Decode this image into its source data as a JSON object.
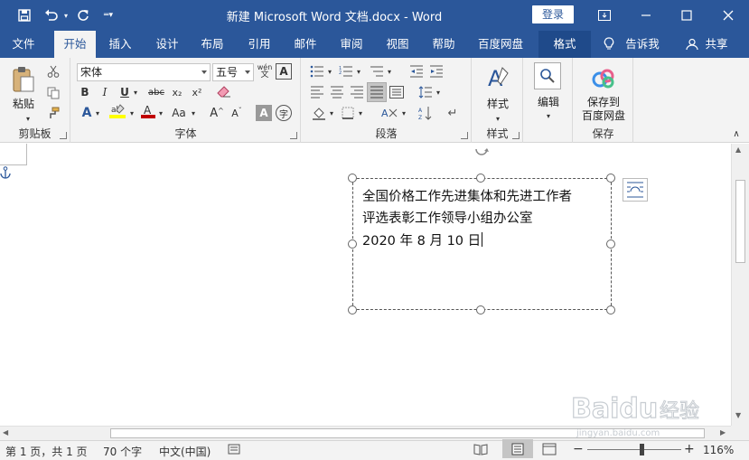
{
  "title_bar": {
    "doc_title": "新建 Microsoft Word 文档.docx  -  Word",
    "login": "登录"
  },
  "tabs": [
    "文件",
    "开始",
    "插入",
    "设计",
    "布局",
    "引用",
    "邮件",
    "审阅",
    "视图",
    "帮助",
    "百度网盘",
    "格式"
  ],
  "tell_me": "告诉我",
  "share": "共享",
  "ribbon": {
    "clipboard": {
      "paste": "粘贴",
      "label": "剪贴板"
    },
    "font": {
      "font_name": "宋体",
      "font_size": "五号",
      "label": "字体",
      "bold": "B",
      "italic": "I",
      "underline": "U",
      "strike": "abc",
      "sub": "x₂",
      "sup": "x²",
      "case": "Aa",
      "grow": "A",
      "shrink": "A",
      "wen": "wén",
      "char_border": "A",
      "char_shade": "A",
      "enclose": "字"
    },
    "paragraph": {
      "label": "段落"
    },
    "styles": {
      "button": "样式",
      "label": "样式"
    },
    "editing": {
      "button": "编辑"
    },
    "save": {
      "button_line1": "保存到",
      "button_line2": "百度网盘",
      "label": "保存"
    }
  },
  "document": {
    "textbox_lines": [
      "全国价格工作先进集体和先进工作者",
      "评选表彰工作领导小组办公室",
      "2020 年 8 月 10 日"
    ]
  },
  "status_bar": {
    "page": "第 1 页，共 1 页",
    "words": "70 个字",
    "language": "中文(中国)",
    "zoom": "116%",
    "zoom_level": 0.58
  },
  "watermark": {
    "brand": "Baidu",
    "suffix": "经验",
    "url": "jingyan.baidu.com"
  },
  "colors": {
    "brand": "#2b579a",
    "highlight": "#ffff00",
    "font_color": "#c00000"
  }
}
